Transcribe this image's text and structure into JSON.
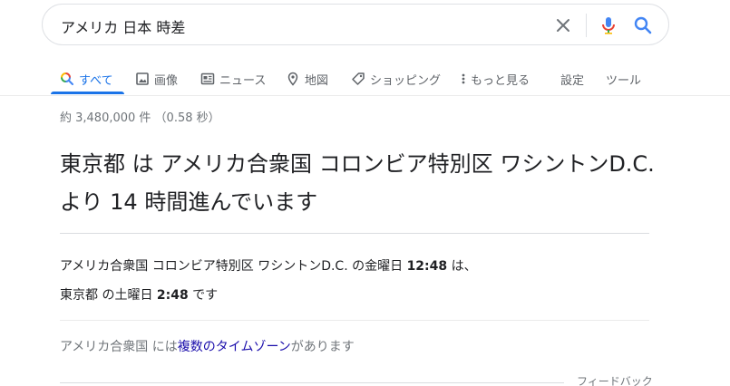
{
  "search": {
    "query": "アメリカ 日本 時差"
  },
  "tabs": [
    {
      "label": "すべて",
      "icon": "search-multicolor-icon",
      "active": true
    },
    {
      "label": "画像",
      "icon": "image-icon"
    },
    {
      "label": "ニュース",
      "icon": "news-icon"
    },
    {
      "label": "地図",
      "icon": "map-pin-icon"
    },
    {
      "label": "ショッピング",
      "icon": "tag-icon"
    },
    {
      "label": "もっと見る",
      "icon": "more-vert-icon"
    },
    {
      "label": "設定"
    },
    {
      "label": "ツール"
    }
  ],
  "stats": "約 3,480,000 件 （0.58 秒）",
  "answer": {
    "line1": "東京都 は アメリカ合衆国 コロンビア特別区 ワシントンD.C.",
    "line2": "より 14 時間進んでいます"
  },
  "details": {
    "row1_prefix": "アメリカ合衆国 コロンビア特別区 ワシントンD.C. の金曜日 ",
    "row1_time": "12:48",
    "row1_suffix": " は、",
    "row2_prefix": "東京都 の土曜日 ",
    "row2_time": "2:48",
    "row2_suffix": " です"
  },
  "timezone_note": {
    "prefix": "アメリカ合衆国 には",
    "link": "複数のタイムゾーン",
    "suffix": "があります"
  },
  "feedback": "フィードバック",
  "colors": {
    "accent": "#1a73e8",
    "link": "#1a0dab",
    "muted": "#70757a"
  }
}
